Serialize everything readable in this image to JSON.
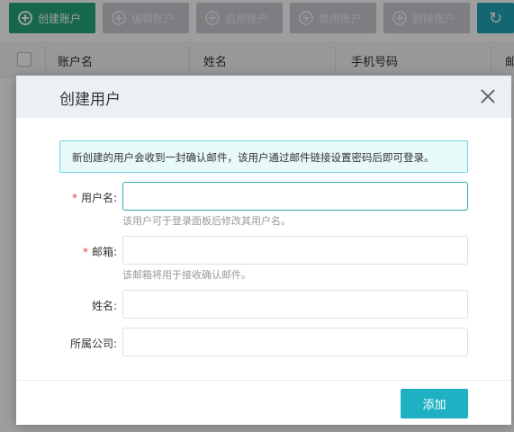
{
  "toolbar": {
    "create_label": "创建账户",
    "edit_label": "编辑账户",
    "enable_label": "启用账户",
    "disable_label": "禁用账户",
    "delete_label": "删除账户",
    "refresh_icon": "↻"
  },
  "table": {
    "columns": [
      "账户名",
      "姓名",
      "手机号码",
      "邮"
    ]
  },
  "modal": {
    "title": "创建用户",
    "notice": "新创建的用户会收到一封确认邮件，该用户通过邮件链接设置密码后即可登录。",
    "required_mark": "*",
    "fields": {
      "username": {
        "label": "用户名:",
        "value": "",
        "hint": "该用户可于登录面板后修改其用户名。"
      },
      "email": {
        "label": "邮箱:",
        "value": "",
        "hint": "该邮箱将用于接收确认邮件。"
      },
      "name": {
        "label": "姓名:",
        "value": ""
      },
      "company": {
        "label": "所属公司:",
        "value": ""
      }
    },
    "submit_label": "添加"
  },
  "colors": {
    "primary": "#25a67e",
    "accent": "#1fb1c3",
    "required": "#e33b3b"
  }
}
